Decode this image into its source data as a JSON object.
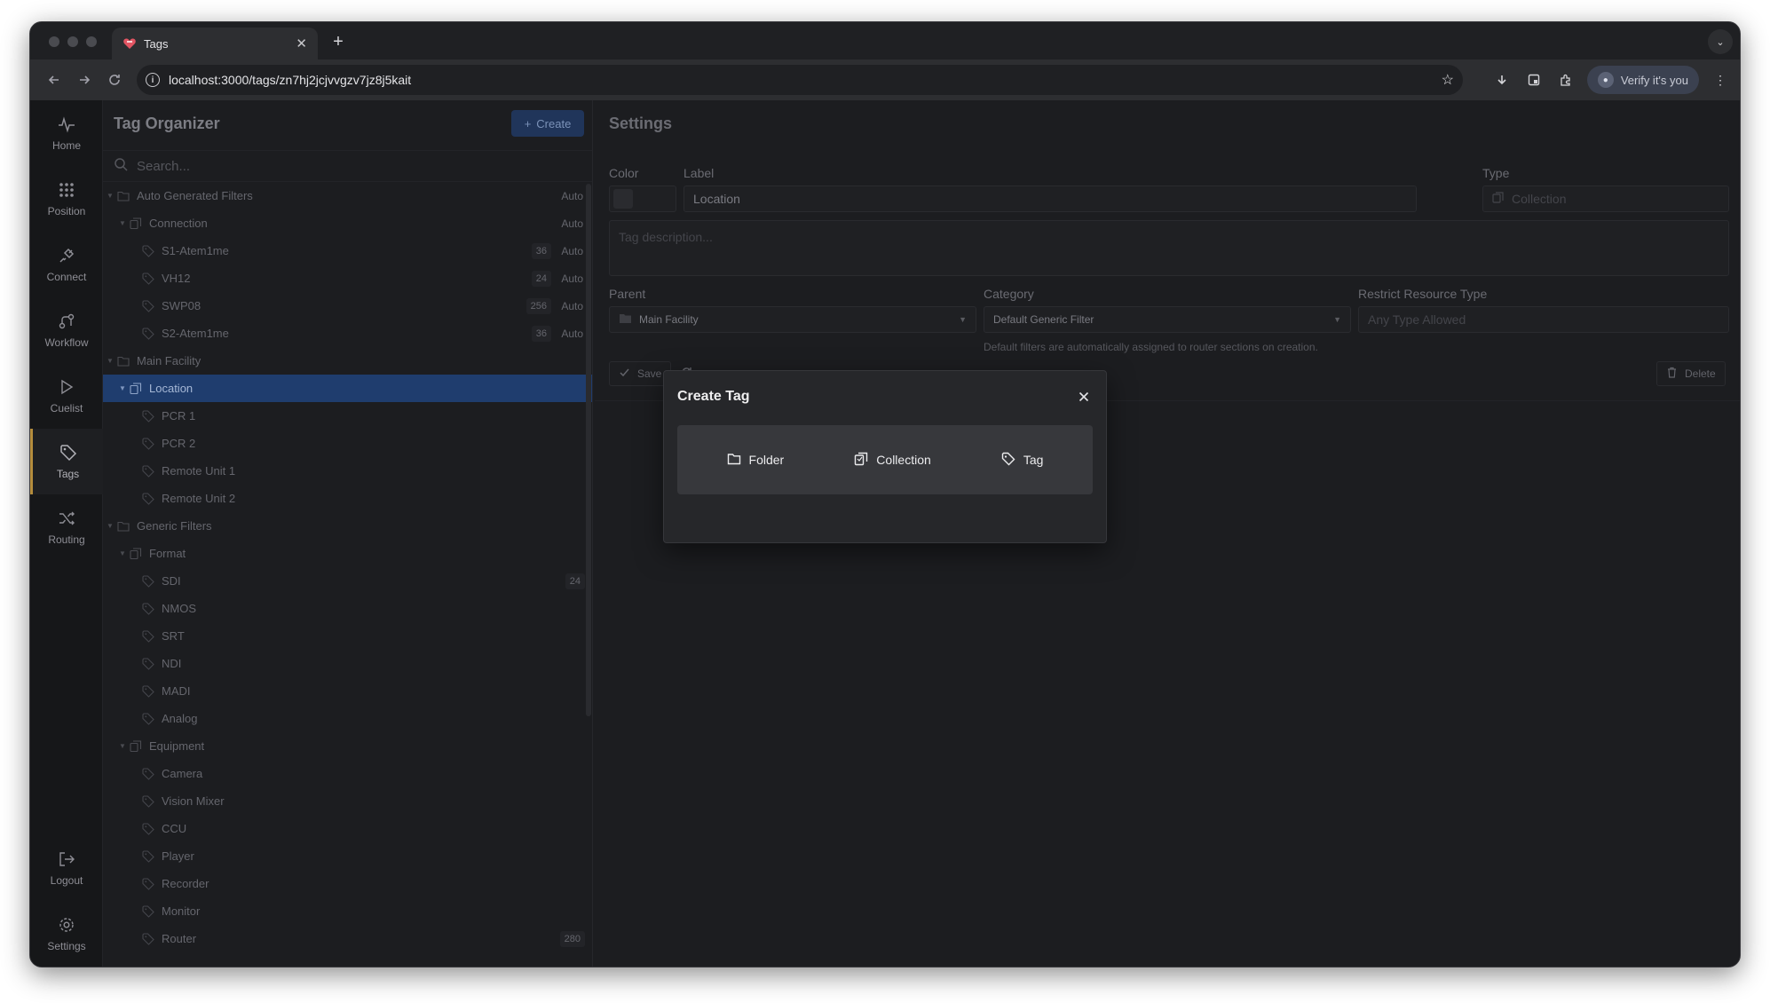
{
  "browser": {
    "tab_title": "Tags",
    "url": "localhost:3000/tags/zn7hj2jcjvvgzv7jz8j5kait",
    "verify_label": "Verify it's you"
  },
  "nav": {
    "items": [
      {
        "label": "Home",
        "icon": "activity-icon"
      },
      {
        "label": "Position",
        "icon": "grid-icon"
      },
      {
        "label": "Connect",
        "icon": "plug-icon"
      },
      {
        "label": "Workflow",
        "icon": "workflow-icon"
      },
      {
        "label": "Cuelist",
        "icon": "play-icon"
      },
      {
        "label": "Tags",
        "icon": "tag-icon",
        "active": true
      },
      {
        "label": "Routing",
        "icon": "shuffle-icon"
      }
    ],
    "bottom": [
      {
        "label": "Logout",
        "icon": "logout-icon"
      },
      {
        "label": "Settings",
        "icon": "gear-icon"
      }
    ]
  },
  "organizer": {
    "title": "Tag Organizer",
    "create_label": "Create",
    "search_placeholder": "Search...",
    "rows": [
      {
        "label": "Auto Generated Filters",
        "type": "folder",
        "level": 0,
        "expanded": true,
        "auto": "Auto"
      },
      {
        "label": "Connection",
        "type": "collection",
        "level": 1,
        "expanded": true,
        "auto": "Auto"
      },
      {
        "label": "S1-Atem1me",
        "type": "tag",
        "level": 2,
        "count": "36",
        "auto": "Auto"
      },
      {
        "label": "VH12",
        "type": "tag",
        "level": 2,
        "count": "24",
        "auto": "Auto"
      },
      {
        "label": "SWP08",
        "type": "tag",
        "level": 2,
        "count": "256",
        "auto": "Auto"
      },
      {
        "label": "S2-Atem1me",
        "type": "tag",
        "level": 2,
        "count": "36",
        "auto": "Auto"
      },
      {
        "label": "Main Facility",
        "type": "folder",
        "level": 0,
        "expanded": true
      },
      {
        "label": "Location",
        "type": "collection",
        "level": 1,
        "expanded": true,
        "selected": true
      },
      {
        "label": "PCR 1",
        "type": "tag",
        "level": 2
      },
      {
        "label": "PCR 2",
        "type": "tag",
        "level": 2
      },
      {
        "label": "Remote Unit 1",
        "type": "tag",
        "level": 2
      },
      {
        "label": "Remote Unit 2",
        "type": "tag",
        "level": 2
      },
      {
        "label": "Generic Filters",
        "type": "folder",
        "level": 0,
        "expanded": true
      },
      {
        "label": "Format",
        "type": "collection",
        "level": 1,
        "expanded": true
      },
      {
        "label": "SDI",
        "type": "tag",
        "level": 2,
        "count": "24"
      },
      {
        "label": "NMOS",
        "type": "tag",
        "level": 2
      },
      {
        "label": "SRT",
        "type": "tag",
        "level": 2
      },
      {
        "label": "NDI",
        "type": "tag",
        "level": 2
      },
      {
        "label": "MADI",
        "type": "tag",
        "level": 2
      },
      {
        "label": "Analog",
        "type": "tag",
        "level": 2
      },
      {
        "label": "Equipment",
        "type": "collection",
        "level": 1,
        "expanded": true
      },
      {
        "label": "Camera",
        "type": "tag",
        "level": 2
      },
      {
        "label": "Vision Mixer",
        "type": "tag",
        "level": 2
      },
      {
        "label": "CCU",
        "type": "tag",
        "level": 2
      },
      {
        "label": "Player",
        "type": "tag",
        "level": 2
      },
      {
        "label": "Recorder",
        "type": "tag",
        "level": 2
      },
      {
        "label": "Monitor",
        "type": "tag",
        "level": 2
      },
      {
        "label": "Router",
        "type": "tag",
        "level": 2,
        "count": "280"
      }
    ]
  },
  "settings": {
    "title": "Settings",
    "color_label": "Color",
    "label_label": "Label",
    "label_value": "Location",
    "type_label": "Type",
    "type_value": "Collection",
    "description_placeholder": "Tag description...",
    "parent_label": "Parent",
    "parent_value": "Main Facility",
    "category_label": "Category",
    "category_value": "Default Generic Filter",
    "category_hint": "Default filters are automatically assigned to router sections on creation.",
    "restrict_label": "Restrict Resource Type",
    "restrict_placeholder": "Any Type Allowed",
    "save_label": "Save",
    "delete_label": "Delete"
  },
  "modal": {
    "title": "Create Tag",
    "options": [
      {
        "label": "Folder",
        "icon": "folder-icon"
      },
      {
        "label": "Collection",
        "icon": "collection-icon"
      },
      {
        "label": "Tag",
        "icon": "tag-icon"
      }
    ]
  }
}
